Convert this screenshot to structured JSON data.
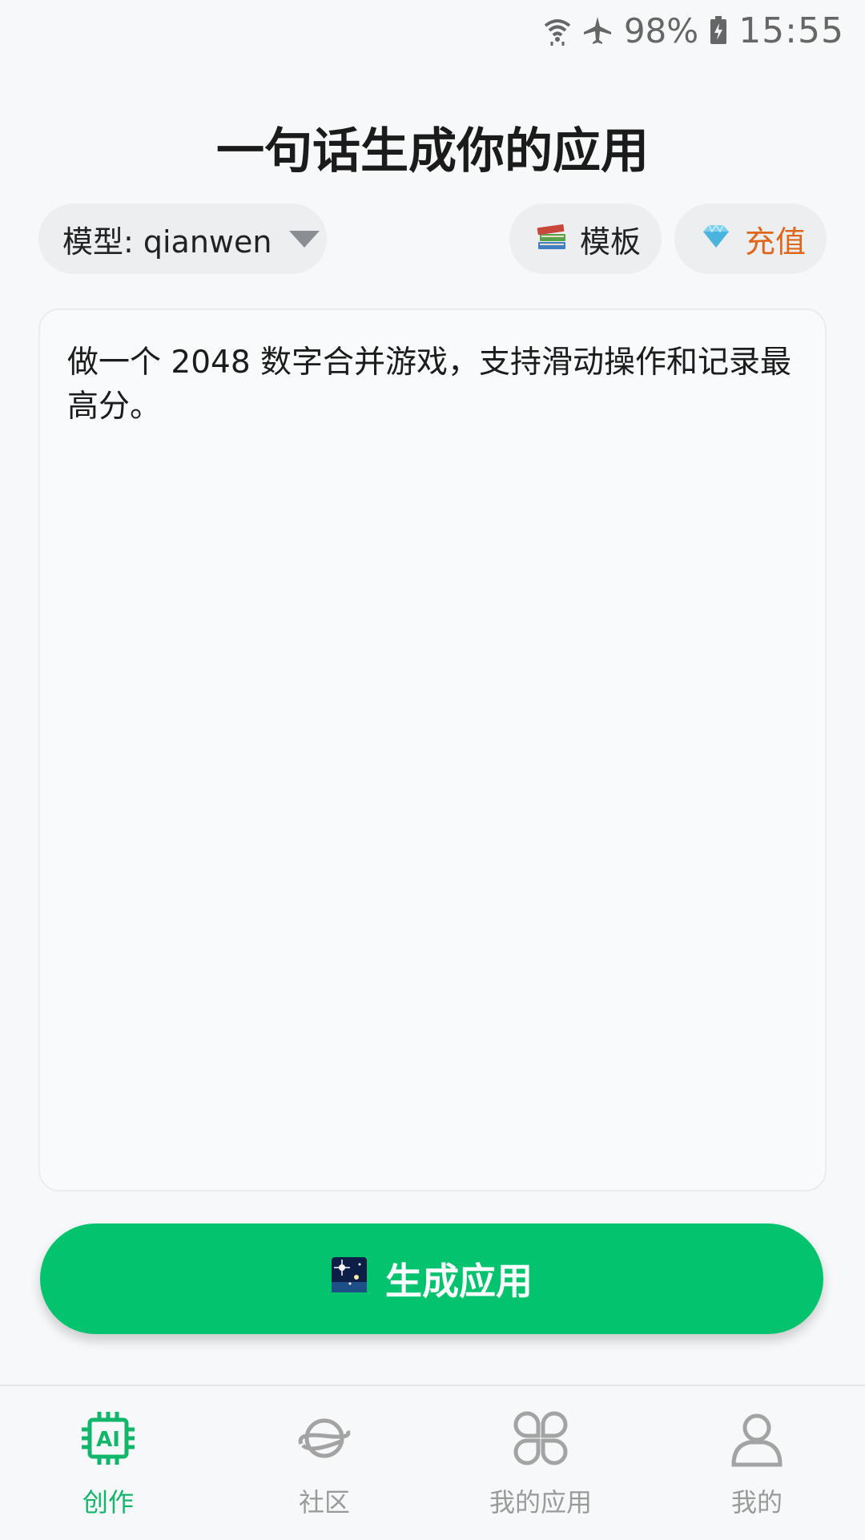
{
  "status_bar": {
    "battery_percent": "98%",
    "time": "15:55",
    "icons": [
      "wifi-icon",
      "airplane-icon",
      "battery-charging-icon"
    ]
  },
  "page_title": "一句话生成你的应用",
  "toolbar": {
    "model_label": "模型: qianwen",
    "template_label": "模板",
    "template_icon": "books-icon",
    "recharge_label": "充值",
    "recharge_icon": "gem-icon",
    "recharge_color": "#e0661c"
  },
  "prompt": {
    "value": "做一个 2048 数字合并游戏，支持滑动操作和记录最高分。"
  },
  "generate_button": {
    "label": "生成应用",
    "icon": "night-sky-icon",
    "color": "#04c36e"
  },
  "bottom_nav": {
    "active_color": "#12b66a",
    "items": [
      {
        "label": "创作",
        "icon": "ai-chip-icon",
        "active": true
      },
      {
        "label": "社区",
        "icon": "planet-icon",
        "active": false
      },
      {
        "label": "我的应用",
        "icon": "apps-grid-icon",
        "active": false
      },
      {
        "label": "我的",
        "icon": "person-icon",
        "active": false
      }
    ]
  }
}
